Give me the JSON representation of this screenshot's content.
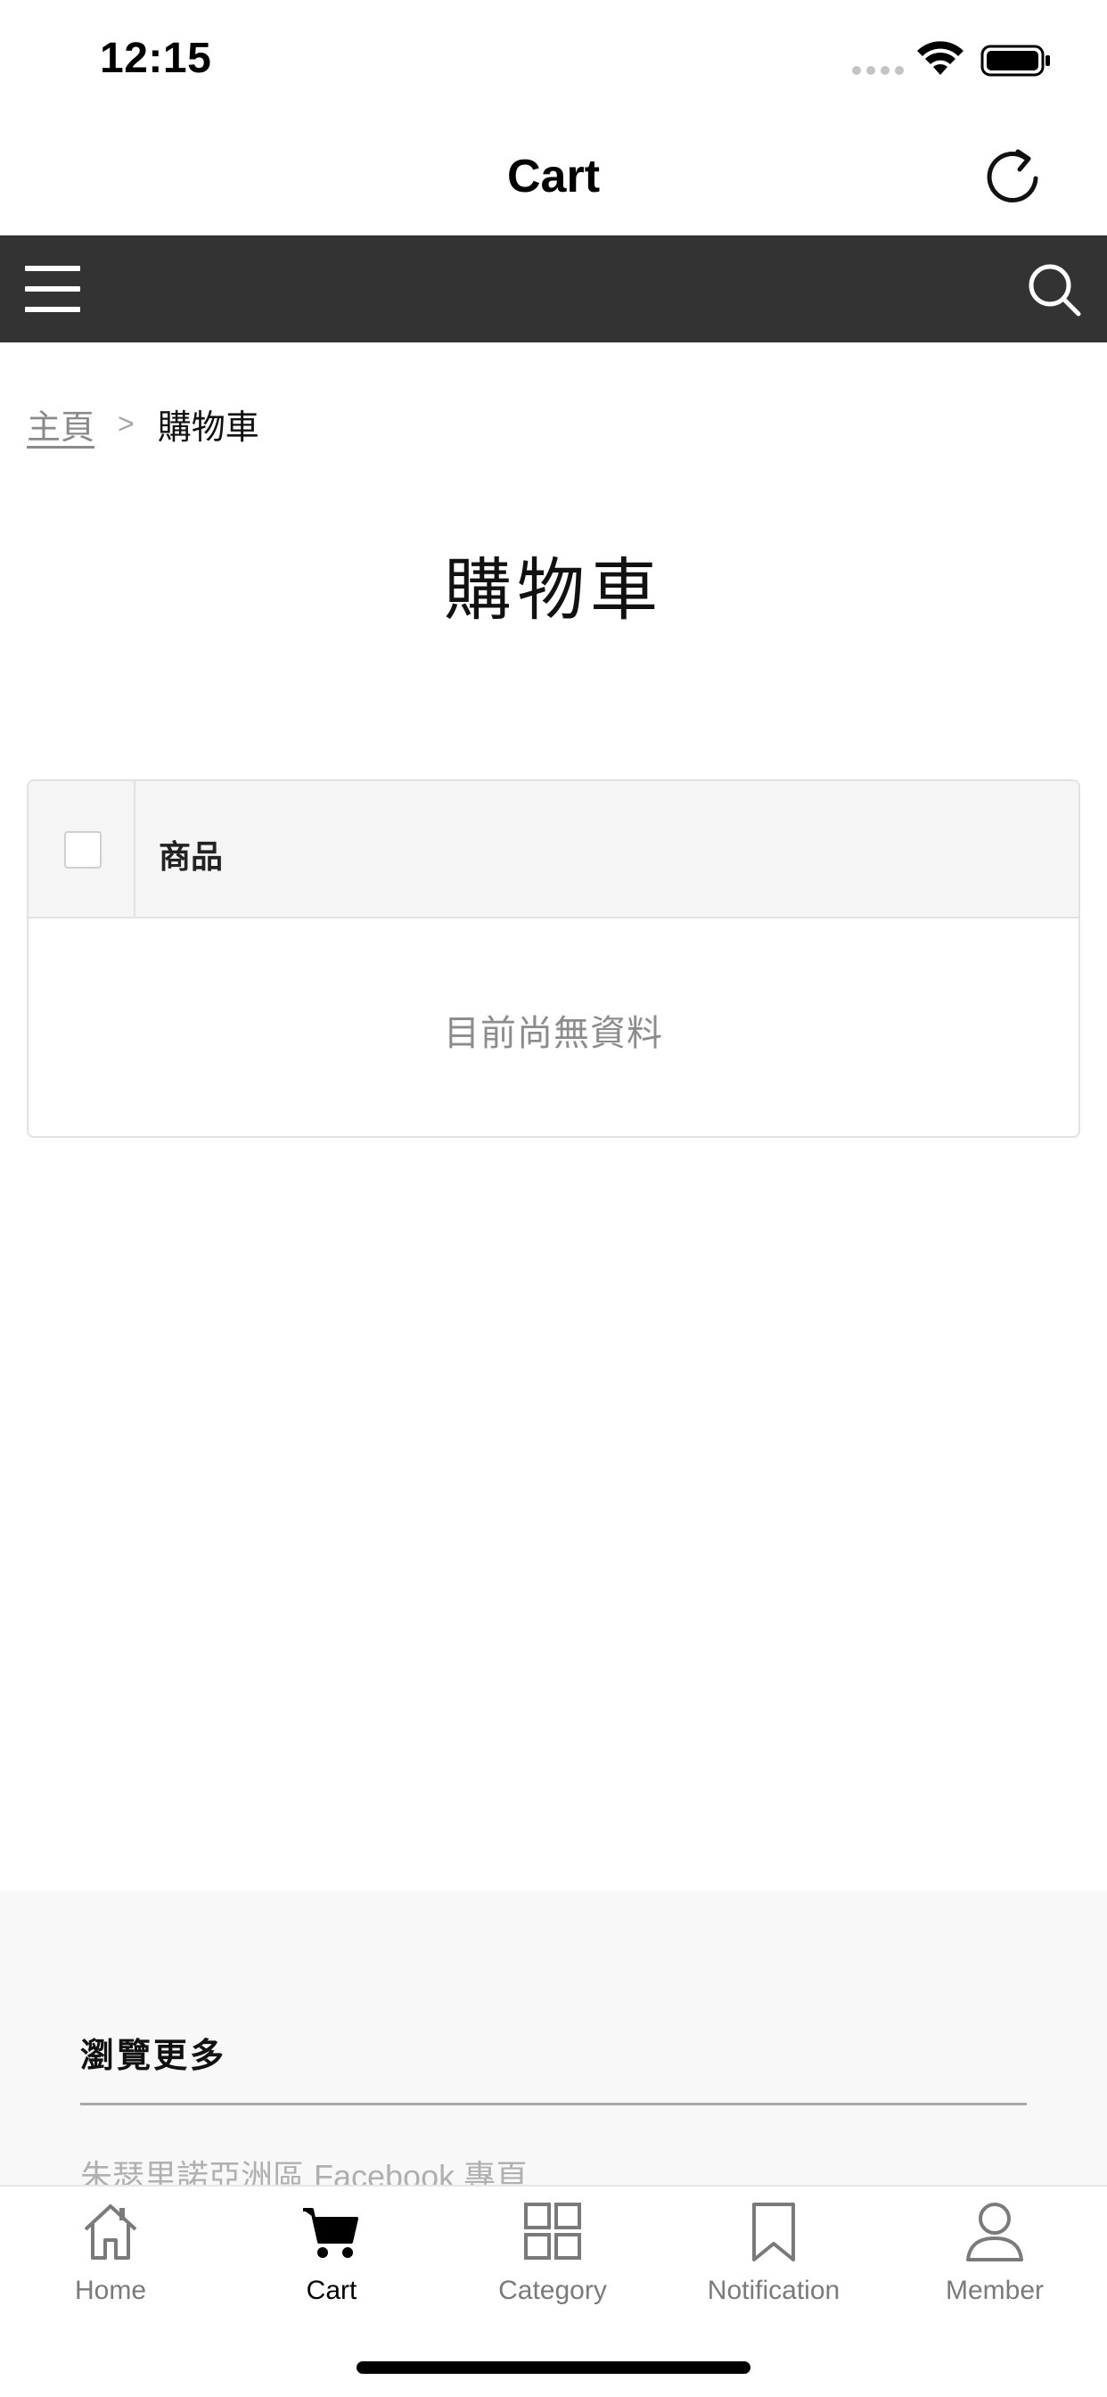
{
  "status_bar": {
    "time": "12:15"
  },
  "nav": {
    "title": "Cart",
    "refresh_icon": "refresh-icon"
  },
  "toolbar": {
    "menu_icon": "hamburger-menu-icon",
    "search_icon": "search-icon"
  },
  "breadcrumb": {
    "home": "主頁",
    "separator": ">",
    "current": "購物車"
  },
  "page": {
    "title": "購物車"
  },
  "cart_table": {
    "column_product": "商品",
    "empty_message": "目前尚無資料"
  },
  "footer": {
    "heading": "瀏覽更多",
    "link": "朱瑟里諾亞洲區 Facebook 專頁"
  },
  "tabs": [
    {
      "label": "Home",
      "icon": "home-icon",
      "active": false
    },
    {
      "label": "Cart",
      "icon": "cart-icon",
      "active": true
    },
    {
      "label": "Category",
      "icon": "grid-icon",
      "active": false
    },
    {
      "label": "Notification",
      "icon": "bookmark-icon",
      "active": false
    },
    {
      "label": "Member",
      "icon": "person-icon",
      "active": false
    }
  ],
  "colors": {
    "toolbar": "#333333",
    "footer_bg": "#f8f8f8",
    "active_tab": "#000000",
    "inactive_tab": "#7a7a7a"
  }
}
